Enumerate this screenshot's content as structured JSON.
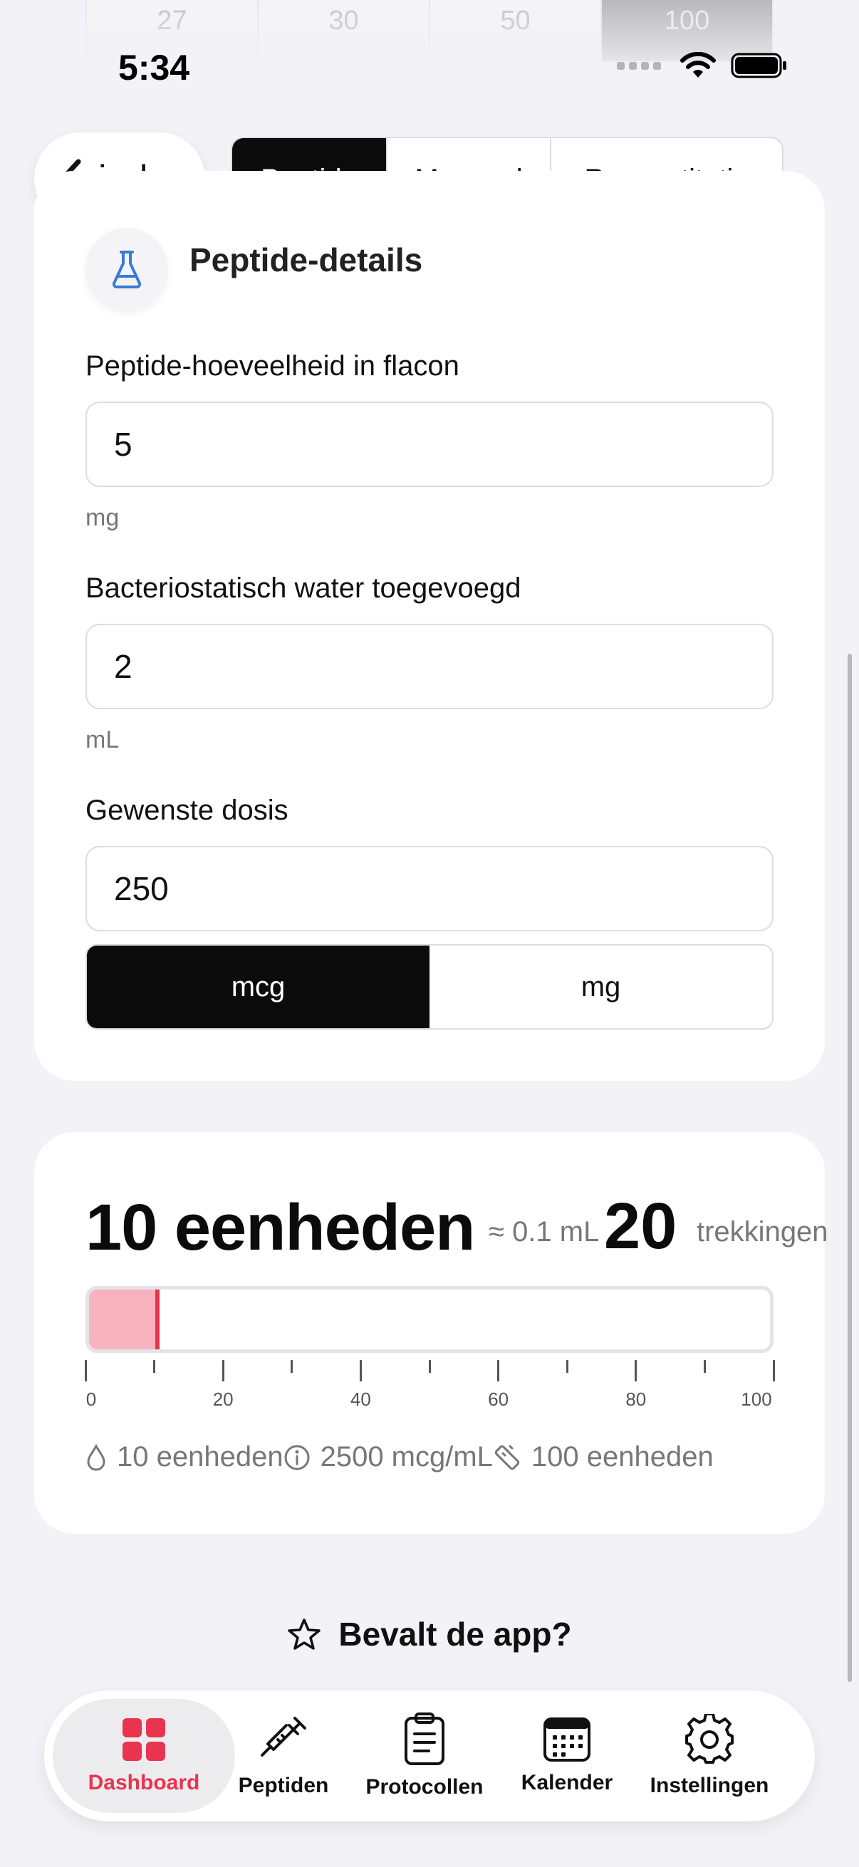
{
  "top_selector": {
    "options": [
      "27",
      "30",
      "50",
      "100"
    ],
    "active": "100"
  },
  "status_bar": {
    "time": "5:34"
  },
  "nav": {
    "back_label": "index",
    "tabs": [
      {
        "label": "Peptide",
        "active": true
      },
      {
        "label": "Mengsel",
        "active": false
      },
      {
        "label": "Reconstitutie",
        "active": false
      }
    ]
  },
  "details_card": {
    "title": "Peptide-details",
    "icon": "flask-icon",
    "fields": [
      {
        "label": "Peptide-hoeveelheid in flacon",
        "value": "5",
        "unit": "mg"
      },
      {
        "label": "Bacteriostatisch water toegevoegd",
        "value": "2",
        "unit": "mL"
      },
      {
        "label": "Gewenste dosis",
        "value": "250"
      }
    ],
    "dose_units": [
      {
        "label": "mcg",
        "active": true
      },
      {
        "label": "mg",
        "active": false
      }
    ]
  },
  "result_card": {
    "units_text": "10 eenheden",
    "ml_text": "≈ 0.1 mL",
    "draws_value": "20",
    "draws_label": "trekkingen",
    "syringe": {
      "capacity": 100,
      "fill_units": 10,
      "tick_labels": [
        "0",
        "20",
        "40",
        "60",
        "80",
        "100"
      ]
    },
    "info": [
      {
        "icon": "drop-icon",
        "text": "10 eenheden"
      },
      {
        "icon": "info-icon",
        "text": "2500 mcg/mL"
      },
      {
        "icon": "ruler-icon",
        "text": "100 eenheden"
      }
    ]
  },
  "rate_prompt": {
    "icon": "star-icon",
    "label": "Bevalt de app?"
  },
  "tab_bar": {
    "items": [
      {
        "label": "Dashboard",
        "icon": "grid-icon",
        "active": true
      },
      {
        "label": "Peptiden",
        "icon": "syringe-icon",
        "active": false
      },
      {
        "label": "Protocollen",
        "icon": "clipboard-icon",
        "active": false
      },
      {
        "label": "Kalender",
        "icon": "calendar-icon",
        "active": false
      },
      {
        "label": "Instellingen",
        "icon": "gear-icon",
        "active": false
      }
    ]
  },
  "colors": {
    "accent": "#e8344f",
    "syringe_fill": "#f8b3c1",
    "flask_blue": "#3a7bd5"
  }
}
